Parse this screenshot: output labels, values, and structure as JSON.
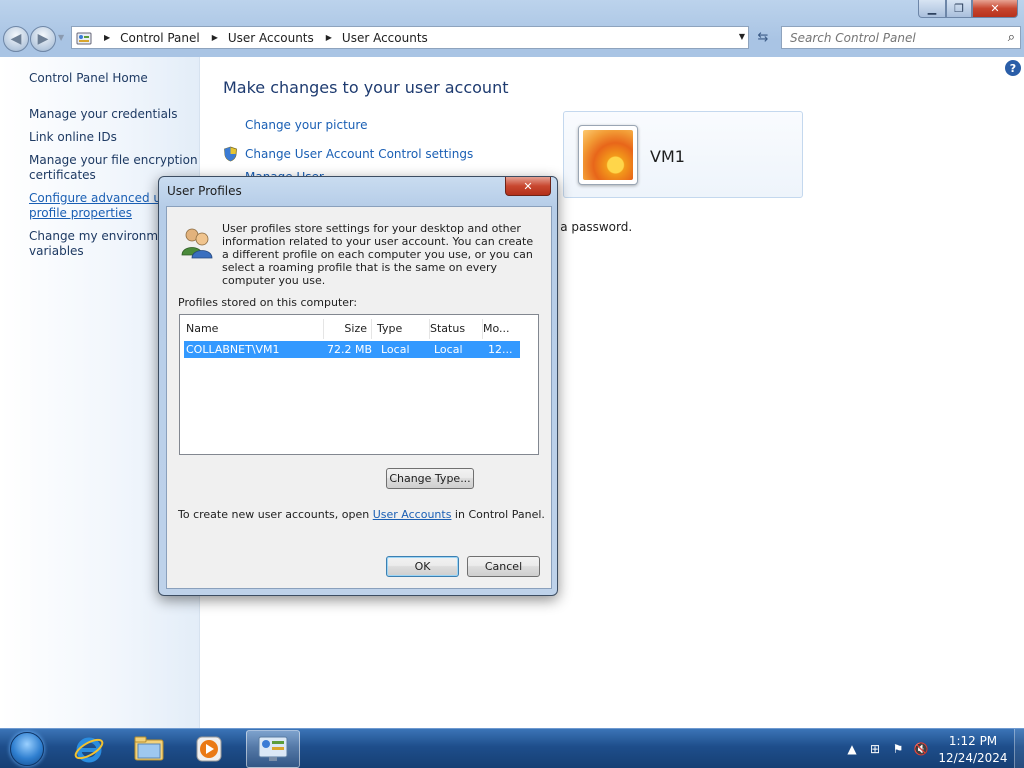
{
  "window": {
    "minimize_glyph": "▁",
    "maximize_glyph": "❐",
    "close_glyph": "✕"
  },
  "nav": {
    "breadcrumbs": [
      "Control Panel",
      "User Accounts",
      "User Accounts"
    ],
    "search_placeholder": "Search Control Panel"
  },
  "sidebar": {
    "home": "Control Panel Home",
    "items": [
      "Manage your credentials",
      "Link online IDs",
      "Manage your file encryption certificates",
      "Configure advanced user profile properties",
      "Change my environment variables"
    ]
  },
  "main": {
    "title": "Make changes to your user account",
    "links": [
      "Change your picture",
      "Change User Account Control settings",
      "Manage User Accounts"
    ],
    "user_name": "VM1",
    "password_text_fragment": "e a password."
  },
  "dialog": {
    "title": "User Profiles",
    "description": "User profiles store settings for your desktop and other information related to your user account. You can create a different profile on each computer you use, or you can select a roaming profile that is the same on every computer you use.",
    "profiles_label": "Profiles stored on this computer:",
    "columns": [
      "Name",
      "Size",
      "Type",
      "Status",
      "Mo..."
    ],
    "rows": [
      {
        "name": "COLLABNET\\VM1",
        "size": "72.2 MB",
        "type": "Local",
        "status": "Local",
        "modified": "12..."
      }
    ],
    "change_type_button": "Change Type...",
    "footer_prefix": "To create new user accounts, open ",
    "footer_link": "User Accounts",
    "footer_suffix": " in Control Panel.",
    "ok_button": "OK",
    "cancel_button": "Cancel"
  },
  "taskbar": {
    "clock_time": "1:12 PM",
    "clock_date": "12/24/2024"
  }
}
